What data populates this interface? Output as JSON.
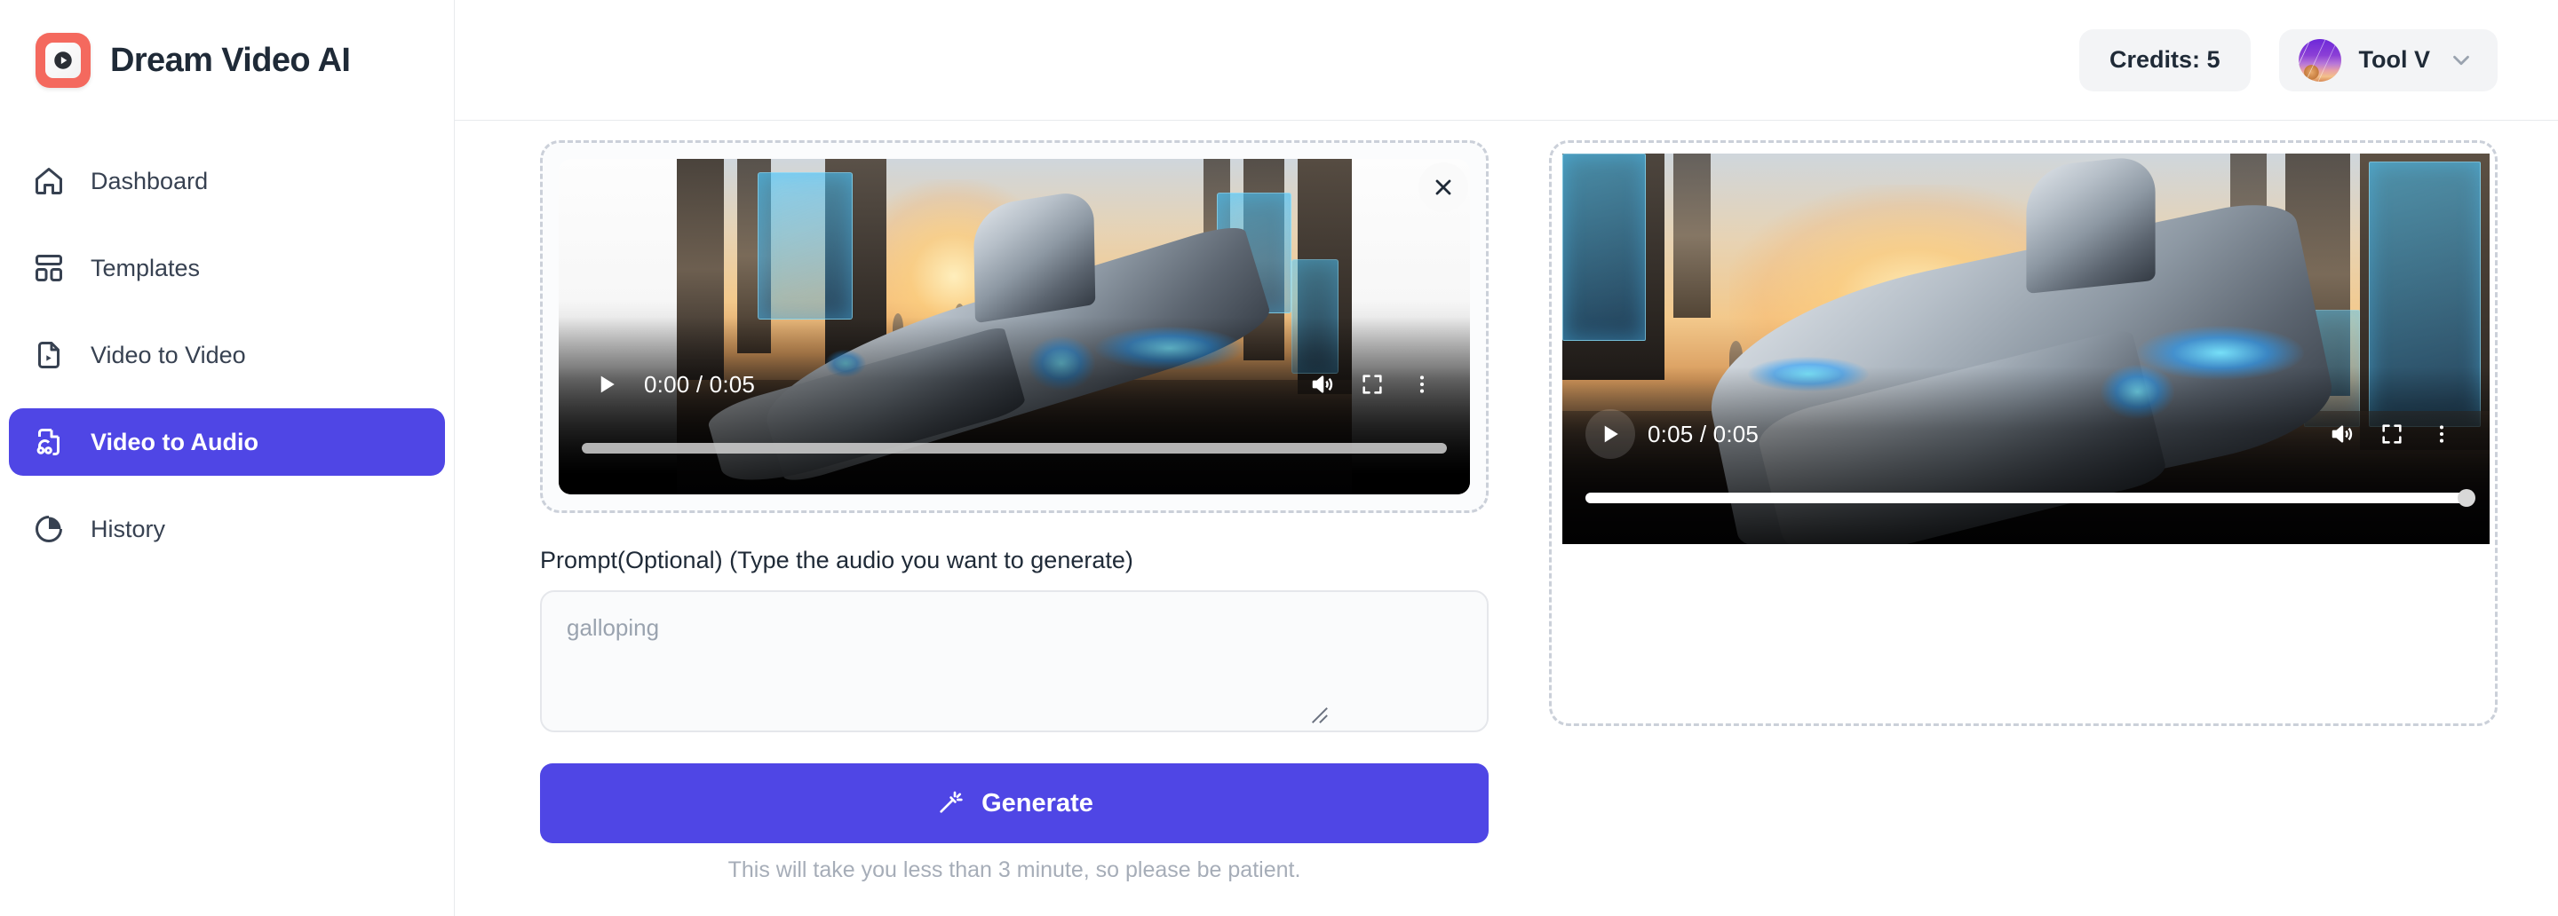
{
  "brand": {
    "title": "Dream Video AI",
    "logo_icon": "video-play-logo-icon"
  },
  "sidebar": {
    "items": [
      {
        "label": "Dashboard",
        "icon": "home-icon",
        "active": false
      },
      {
        "label": "Templates",
        "icon": "layout-grid-icon",
        "active": false
      },
      {
        "label": "Video to Video",
        "icon": "file-video-icon",
        "active": false
      },
      {
        "label": "Video to Audio",
        "icon": "file-audio-icon",
        "active": true
      },
      {
        "label": "History",
        "icon": "pie-chart-clock-icon",
        "active": false
      }
    ]
  },
  "topbar": {
    "credits_label": "Credits: 5",
    "user_name": "Tool V",
    "avatar_icon": "user-avatar",
    "chevron_icon": "chevron-down-icon"
  },
  "upload_panel": {
    "close_icon": "close-icon",
    "player": {
      "play_icon": "play-icon",
      "time_display": "0:00 / 0:05",
      "current_time": "0:00",
      "duration": "0:05",
      "progress_percent": 0,
      "mute_icon": "volume-icon",
      "fullscreen_icon": "fullscreen-icon",
      "more_icon": "more-vertical-icon"
    }
  },
  "prompt": {
    "label": "Prompt(Optional)  (Type the audio you want to generate)",
    "placeholder": "galloping",
    "value": ""
  },
  "generate": {
    "label": "Generate",
    "icon": "magic-wand-icon",
    "hint": "This will take you less than 3 minute, so please be patient."
  },
  "result_panel": {
    "player": {
      "play_icon": "play-icon",
      "time_display": "0:05 / 0:05",
      "current_time": "0:05",
      "duration": "0:05",
      "progress_percent": 100,
      "mute_icon": "volume-icon",
      "fullscreen_icon": "fullscreen-icon",
      "more_icon": "more-vertical-icon"
    }
  },
  "colors": {
    "accent": "#4f46e5",
    "logo": "#f4695e",
    "text": "#1f2a37",
    "muted": "#9aa3af",
    "border": "#e8eaed",
    "dashed_border": "#cbd0d9"
  }
}
